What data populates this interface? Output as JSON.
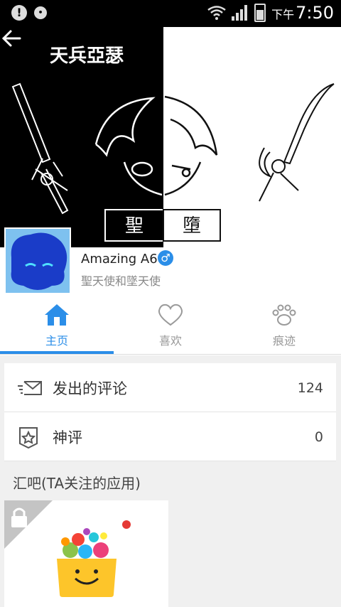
{
  "status_bar": {
    "ampm": "下午",
    "time": "7:50"
  },
  "header": {
    "title": "天兵亞瑟",
    "cover_text_left": "聖",
    "cover_text_right": "墮"
  },
  "profile": {
    "username": "Amazing A6",
    "gender_symbol": "♂",
    "subtitle": "聖天使和墜天使"
  },
  "tabs": [
    {
      "label": "主页",
      "icon": "home-icon",
      "active": true
    },
    {
      "label": "喜欢",
      "icon": "heart-icon",
      "active": false
    },
    {
      "label": "痕迹",
      "icon": "paw-icon",
      "active": false
    }
  ],
  "stats": [
    {
      "label": "发出的评论",
      "value": "124",
      "icon": "envelope-icon"
    },
    {
      "label": "神评",
      "value": "0",
      "icon": "star-badge-icon"
    }
  ],
  "section_title": "汇吧(TA关注的应用)",
  "colors": {
    "accent": "#2b8ee8",
    "badge": "#e53935"
  }
}
